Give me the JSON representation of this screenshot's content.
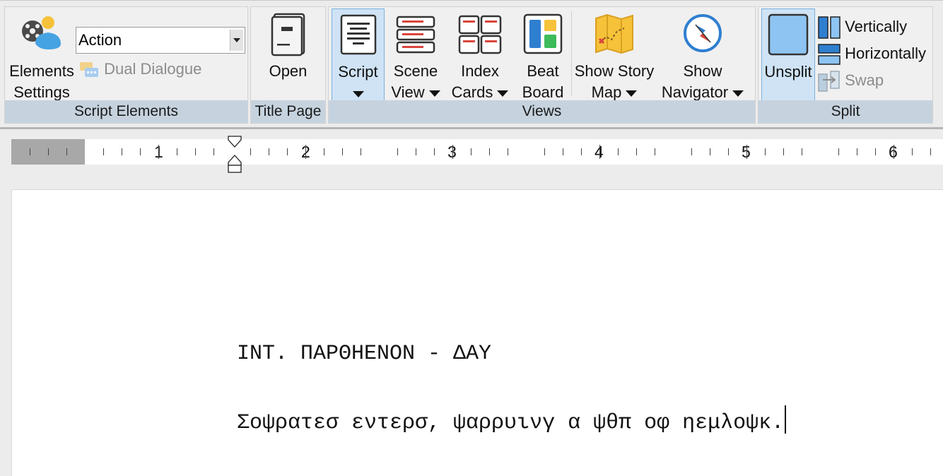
{
  "ribbon": {
    "script_elements": {
      "label": "Script Elements",
      "elements_settings_line1": "Elements",
      "elements_settings_line2": "Settings",
      "element_select_value": "Action",
      "dual_dialogue": "Dual Dialogue"
    },
    "title_page": {
      "label": "Title Page",
      "open": "Open"
    },
    "views": {
      "label": "Views",
      "script": "Script",
      "scene_view_line1": "Scene",
      "scene_view_line2": "View",
      "index_cards_line1": "Index",
      "index_cards_line2": "Cards",
      "beat_board_line1": "Beat",
      "beat_board_line2": "Board",
      "story_map_line1": "Show Story",
      "story_map_line2": "Map",
      "navigator_line1": "Show",
      "navigator_line2": "Navigator"
    },
    "split": {
      "label": "Split",
      "unsplit": "Unsplit",
      "vertically": "Vertically",
      "horizontally": "Horizontally",
      "swap": "Swap"
    }
  },
  "ruler": {
    "numbers": [
      "1",
      "2",
      "3",
      "4",
      "5",
      "6"
    ]
  },
  "document": {
    "scene_heading": "INT. ΠΑΡΘΗΕΝΟΝ - ΔΑΥ",
    "action": "Σοψρατεσ εντερσ, ψαρρυινγ α ψθπ οφ ηεμλοψκ."
  },
  "colors": {
    "group_label_bg": "#c6d3df",
    "active_button_bg": "#cfe3f5",
    "accent_red": "#d9453b",
    "accent_blue": "#2f7fd0"
  }
}
